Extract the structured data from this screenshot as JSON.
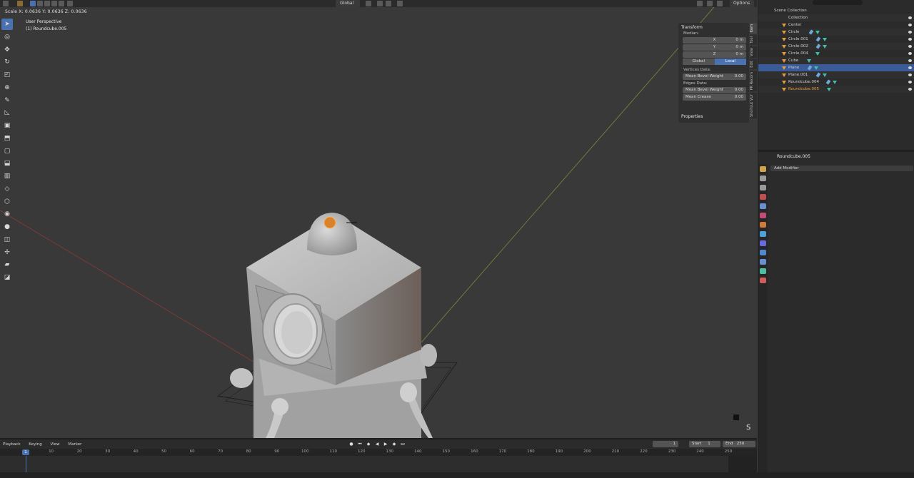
{
  "header": {
    "orientation_label": "Global",
    "options_label": "Options"
  },
  "viewport": {
    "scale_readout": "Scale X: 0.0636   Y: 0.0636   Z: 0.0636",
    "view_title": "User Perspective",
    "active_object": "(1) Roundcube.005",
    "corner_label": "S"
  },
  "toolbar": {
    "tools": [
      "select-box",
      "cursor",
      "move",
      "rotate",
      "scale",
      "transform",
      "annotate",
      "measure",
      "add-cube",
      "extrude",
      "inset",
      "bevel",
      "loop-cut",
      "knife",
      "poly-build",
      "spin",
      "smooth",
      "edge-slide",
      "shrink-fatten",
      "shear",
      "rip"
    ]
  },
  "npanel": {
    "transform_title": "Transform",
    "median_label": "Median:",
    "fields": [
      {
        "axis": "X",
        "value": "0 m"
      },
      {
        "axis": "Y",
        "value": "0 m"
      },
      {
        "axis": "Z",
        "value": "0 m"
      }
    ],
    "global_label": "Global",
    "local_label": "Local",
    "vertices_data_label": "Vertices Data:",
    "vertex_bevel_label": "Mean Bevel Weight",
    "vertex_bevel_value": "0.00",
    "edges_data_label": "Edges Data:",
    "edge_bevel_label": "Mean Bevel Weight",
    "edge_bevel_value": "0.00",
    "crease_label": "Mean Crease",
    "crease_value": "0.00",
    "properties_title": "Properties"
  },
  "vtabs": [
    "Item",
    "Tool",
    "View",
    "Edit",
    "PR Recorn",
    "Shortcut VUr"
  ],
  "outliner": {
    "scene_collection": "Scene Collection",
    "collection": "Collection",
    "items": [
      {
        "name": "Center"
      },
      {
        "name": "Circle"
      },
      {
        "name": "Circle.001"
      },
      {
        "name": "Circle.002"
      },
      {
        "name": "Circle.004"
      },
      {
        "name": "Cube"
      },
      {
        "name": "Plane"
      },
      {
        "name": "Plane.001"
      },
      {
        "name": "Roundcube.004"
      },
      {
        "name": "Roundcube.005"
      }
    ]
  },
  "properties": {
    "object_name": "Roundcube.005",
    "add_modifier_label": "Add Modifier",
    "tab_colors": [
      "#d0a24a",
      "#9a9a9a",
      "#c05050",
      "#6a8fd0",
      "#d07a3a",
      "#4ea0d8",
      "#6a6ae0",
      "#4ec0a0",
      "#d05c5c",
      "#c04c78"
    ]
  },
  "timeline": {
    "menu": [
      "Playback",
      "Keying",
      "View",
      "Marker"
    ],
    "current_frame": "1",
    "start_label": "Start",
    "start_value": "1",
    "end_label": "End",
    "end_value": "250",
    "ruler_ticks": [
      "1",
      "10",
      "20",
      "30",
      "40",
      "50",
      "60",
      "70",
      "80",
      "90",
      "100",
      "110",
      "120",
      "130",
      "140",
      "150",
      "160",
      "170",
      "180",
      "190",
      "200",
      "210",
      "220",
      "230",
      "240",
      "250"
    ]
  }
}
